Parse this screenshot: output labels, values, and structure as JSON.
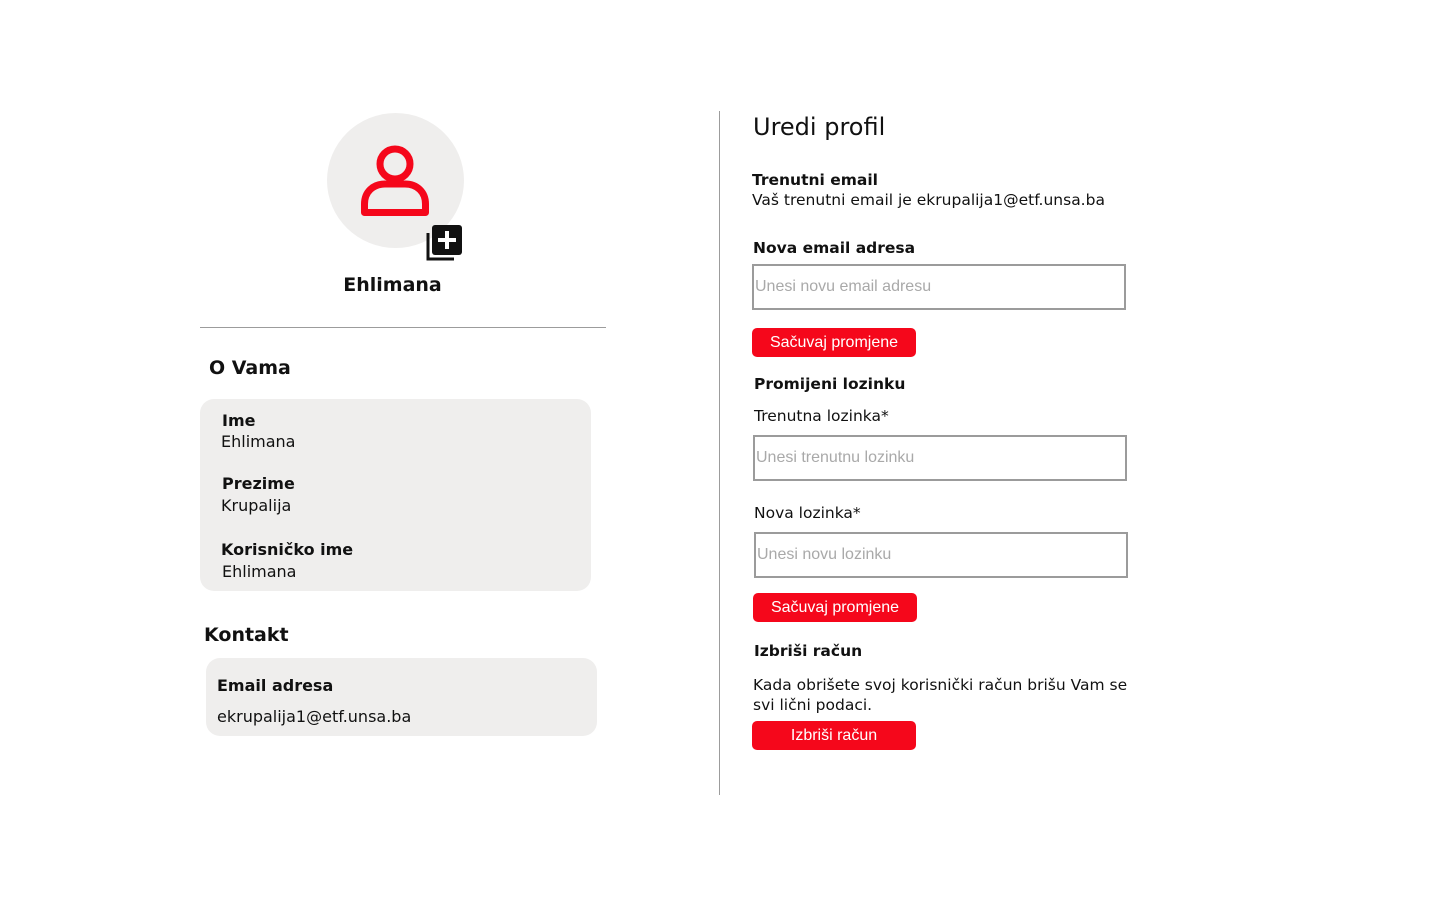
{
  "profile": {
    "username": "Ehlimana",
    "avatar_icon": "user-icon",
    "add_photo_icon": "add-photo-icon",
    "accent_color": "#f5071b"
  },
  "about": {
    "title": "O Vama",
    "first_name_label": "Ime",
    "first_name_value": "Ehlimana",
    "last_name_label": "Prezime",
    "last_name_value": "Krupalija",
    "username_label": "Korisničko ime",
    "username_value": "Ehlimana"
  },
  "contact": {
    "title": "Kontakt",
    "email_label": "Email adresa",
    "email_value": "ekrupalija1@etf.unsa.ba"
  },
  "edit": {
    "title": "Uredi profil",
    "current_email_label": "Trenutni email",
    "current_email_text": "Vaš trenutni email je ekrupalija1@etf.unsa.ba",
    "new_email_label": "Nova email adresa",
    "new_email_placeholder": "Unesi novu email adresu",
    "save_email_button": "Sačuvaj promjene",
    "change_password_title": "Promijeni lozinku",
    "current_password_label": "Trenutna lozinka*",
    "current_password_placeholder": "Unesi trenutnu lozinku",
    "new_password_label": "Nova lozinka*",
    "new_password_placeholder": "Unesi novu lozinku",
    "save_password_button": "Sačuvaj promjene",
    "delete_title": "Izbriši račun",
    "delete_text_line1": "Kada obrišete svoj korisnički račun brišu Vam se",
    "delete_text_line2": "svi lični podaci.",
    "delete_button": "Izbriši račun"
  }
}
